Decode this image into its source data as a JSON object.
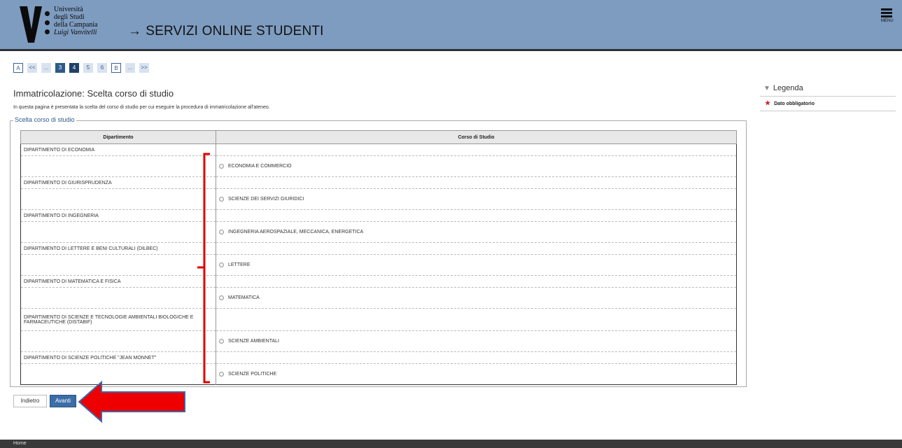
{
  "header": {
    "logo_lines": [
      "Università",
      "degli Studi",
      "della Campania",
      "Luigi Vanvitelli"
    ],
    "arrow": "→",
    "title": "SERVIZI ONLINE STUDENTI",
    "menu_label": "MENU",
    "bg_color": "#7e9cc0"
  },
  "steps": [
    "A",
    "<<",
    "...",
    "3",
    "4",
    "5",
    "6",
    "B",
    "...",
    ">>"
  ],
  "current_step": "4",
  "page": {
    "title": "Immatricolazione: Scelta corso di studio",
    "description": "In questa pagina è presentata la scelta del corso di studio per cui eseguire la procedura di immatricolazione all'ateneo."
  },
  "form": {
    "legend": "Scelta corso di studio",
    "headers": [
      "Dipartimento",
      "Corso di Studio"
    ],
    "groups": [
      {
        "department": "DIPARTIMENTO DI ECONOMIA",
        "course": "ECONOMIA E COMMERCIO"
      },
      {
        "department": "DIPARTIMENTO DI GIURISPRUDENZA",
        "course": "SCIENZE DEI SERVIZI GIURIDICI"
      },
      {
        "department": "DIPARTIMENTO DI INGEGNERIA",
        "course": "INGEGNERIA AEROSPAZIALE, MECCANICA, ENERGETICA"
      },
      {
        "department": "DIPARTIMENTO DI LETTERE E BENI CULTURALI (DILBEC)",
        "course": "LETTERE"
      },
      {
        "department": "DIPARTIMENTO DI MATEMATICA E FISICA",
        "course": "MATEMATICA"
      },
      {
        "department": "DIPARTIMENTO DI SCIENZE E TECNOLOGIE AMBIENTALI BIOLOGICHE E FARMACEUTICHE (DISTABIF)",
        "course": "SCIENZE AMBIENTALI"
      },
      {
        "department": "DIPARTIMENTO DI SCIENZE POLITICHE \"JEAN MONNET\"",
        "course": "SCIENZE POLITICHE"
      }
    ]
  },
  "buttons": {
    "back": "Indietro",
    "next": "Avanti"
  },
  "sidebar": {
    "legend_title": "Legenda",
    "required": "Dato obbligatorio"
  },
  "footer": {
    "home": "Home"
  },
  "colors": {
    "accent": "#2e5a8a",
    "annotation": "#e00000",
    "required_star": "#d42020"
  }
}
